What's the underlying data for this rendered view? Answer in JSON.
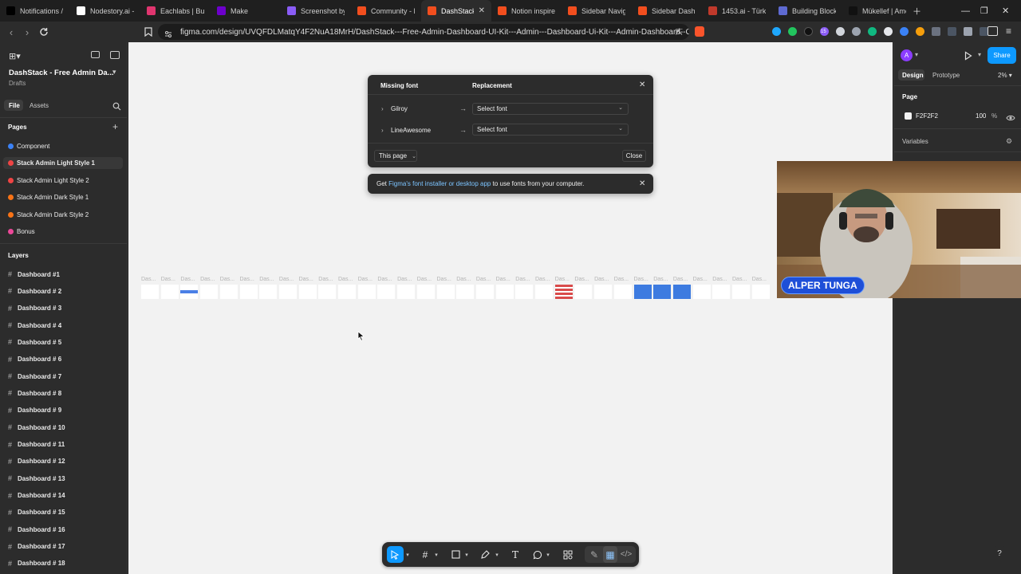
{
  "browser": {
    "tabs": [
      {
        "label": "Notifications / X",
        "color": "#000000"
      },
      {
        "label": "Nodestory.ai - ",
        "color": "#ffffff"
      },
      {
        "label": "Eachlabs | Build",
        "color": "#e0356f"
      },
      {
        "label": "Make",
        "color": "#6d00cc"
      },
      {
        "label": "Screenshot by",
        "color": "#8a5cf6"
      },
      {
        "label": "Community - F",
        "color": "#f24e1e"
      },
      {
        "label": "DashStack",
        "color": "#f24e1e"
      },
      {
        "label": "Notion inspired",
        "color": "#f24e1e"
      },
      {
        "label": "Sidebar Naviga",
        "color": "#f24e1e"
      },
      {
        "label": "Sidebar Dashb",
        "color": "#f24e1e"
      },
      {
        "label": "1453.ai - Türk A",
        "color": "#c0392b"
      },
      {
        "label": "Building Blocks",
        "color": "#5e6ad2"
      },
      {
        "label": "Mükellef | Ame",
        "color": "#111111"
      }
    ],
    "active_tab_index": 6,
    "url": "figma.com/design/UVQFDLMatqY4F2NuA18MrH/DashStack---Free-Admin-Dashboard-UI-Kit---Admin---Dashboard-Ui-Kit---Admin-Dashboard--C...",
    "ext_badge": "15"
  },
  "left_panel": {
    "file_title": "DashStack - Free Admin Da...",
    "file_subtitle": "Drafts",
    "tab_file": "File",
    "tab_assets": "Assets",
    "pages_header": "Pages",
    "pages": [
      {
        "label": "Component",
        "color": "#3b82f6"
      },
      {
        "label": "Stack Admin Light Style 1",
        "color": "#ef4444"
      },
      {
        "label": "Stack Admin Light Style 2",
        "color": "#ef4444"
      },
      {
        "label": "Stack Admin Dark Style 1",
        "color": "#f97316"
      },
      {
        "label": "Stack Admin Dark Style 2",
        "color": "#f97316"
      },
      {
        "label": "Bonus",
        "color": "#ec4899"
      }
    ],
    "active_page_index": 1,
    "layers_header": "Layers",
    "layers": [
      "Dashboard #1",
      "Dashboard # 2",
      "Dashboard # 3",
      "Dashboard # 4",
      "Dashboard # 5",
      "Dashboard # 6",
      "Dashboard # 7",
      "Dashboard # 8",
      "Dashboard # 9",
      "Dashboard # 10",
      "Dashboard # 11",
      "Dashboard # 12",
      "Dashboard # 13",
      "Dashboard # 14",
      "Dashboard # 15",
      "Dashboard # 16",
      "Dashboard # 17",
      "Dashboard # 18"
    ]
  },
  "canvas": {
    "background": "#F2F2F2",
    "frame_label": "Das..."
  },
  "missing_font_dialog": {
    "col_missing": "Missing font",
    "col_replacement": "Replacement",
    "rows": [
      {
        "font": "Gilroy",
        "replacement": "Select font"
      },
      {
        "font": "LineAwesome",
        "replacement": "Select font"
      }
    ],
    "scope": "This page",
    "close_label": "Close"
  },
  "font_notice": {
    "prefix": "Get ",
    "link": "Figma's font installer or desktop app",
    "suffix": " to use fonts from your computer."
  },
  "right_panel": {
    "avatar": "A",
    "share": "Share",
    "tab_design": "Design",
    "tab_prototype": "Prototype",
    "zoom": "2%",
    "page_header": "Page",
    "page_color": "F2F2F2",
    "page_opacity": "100",
    "percent": "%",
    "variables": "Variables"
  },
  "webcam": {
    "name": "ALPER TUNGA"
  },
  "help": "?"
}
